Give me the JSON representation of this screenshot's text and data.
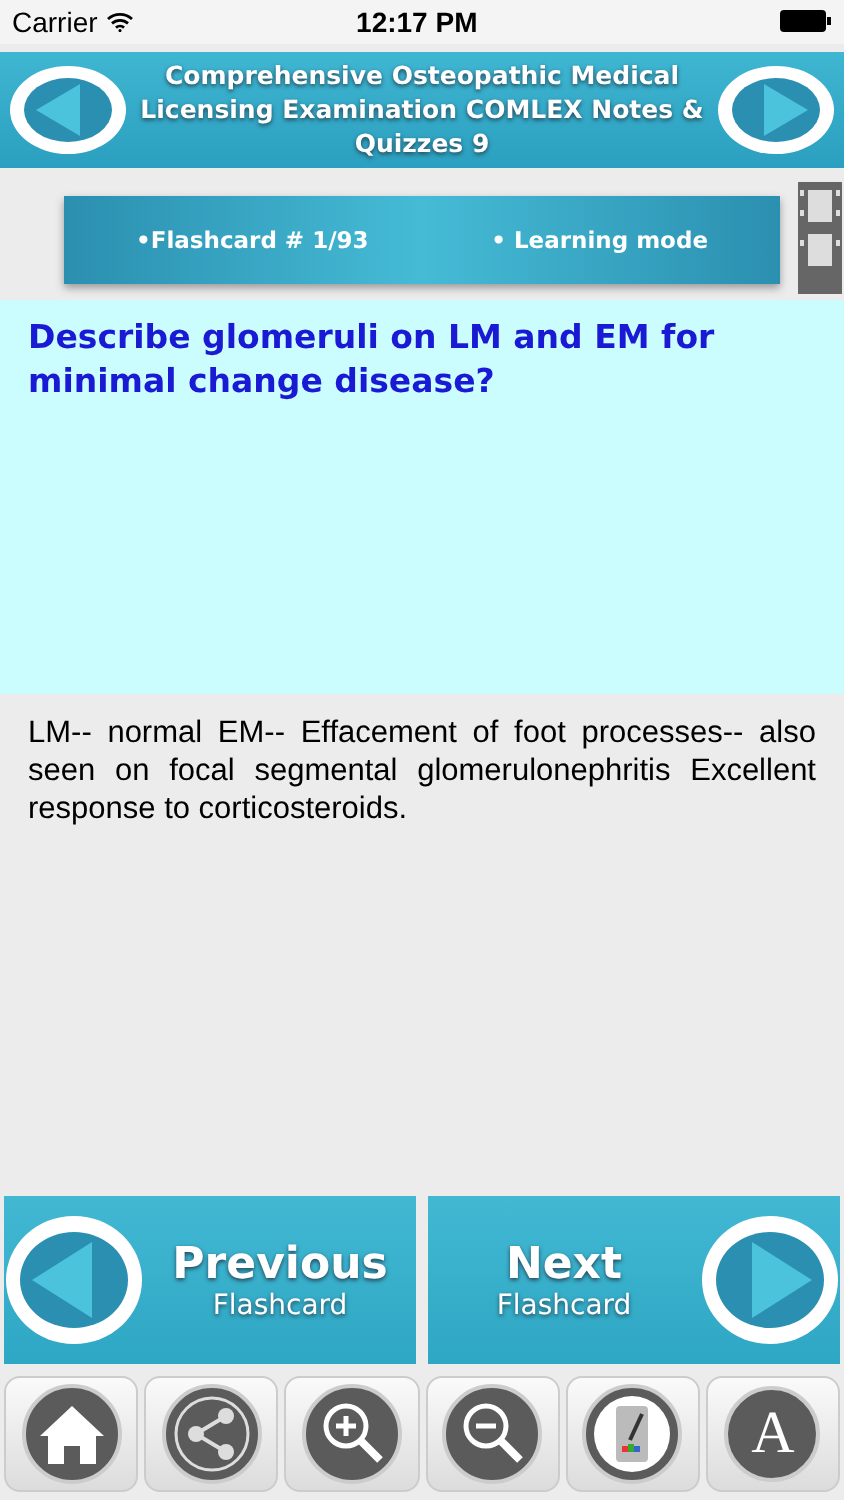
{
  "status_bar": {
    "carrier": "Carrier",
    "time": "12:17 PM"
  },
  "header": {
    "title": "Comprehensive Osteopathic Medical Licensing Examination COMLEX Notes & Quizzes 9"
  },
  "info_bar": {
    "counter": "•Flashcard #  1/93",
    "mode": "• Learning mode"
  },
  "question": "Describe glomeruli on LM and EM for minimal change disease?",
  "answer": "LM-- normal EM-- Effacement of foot processes-- also seen on focal segmental glomerulonephritis Excellent response to corticosteroids.",
  "nav": [
    {
      "kind": "previous",
      "label": "Previous",
      "sublabel": "Flashcard"
    },
    {
      "kind": "next",
      "label": "Next",
      "sublabel": "Flashcard"
    }
  ],
  "toolbar": [
    {
      "kind": "home"
    },
    {
      "kind": "share"
    },
    {
      "kind": "zoom-in"
    },
    {
      "kind": "zoom-out"
    },
    {
      "kind": "color"
    },
    {
      "kind": "font",
      "glyph": "A"
    }
  ]
}
